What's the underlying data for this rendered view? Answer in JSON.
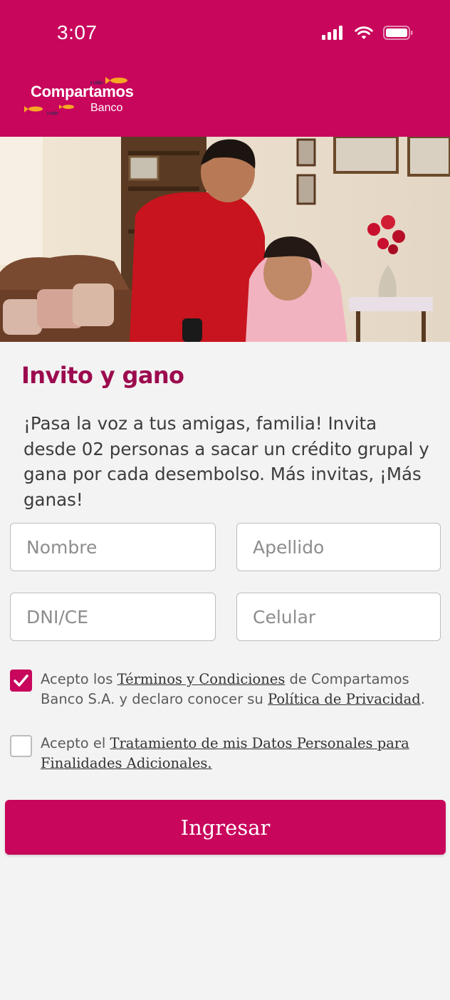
{
  "status_bar": {
    "time": "3:07"
  },
  "brand": {
    "name": "Compartamos",
    "sub": "Banco"
  },
  "page": {
    "title": "Invito y gano",
    "description": "¡Pasa la voz a tus amigas, familia! Invita desde 02 personas a sacar un crédito grupal y gana por cada desembolso. Más invitas, ¡Más ganas!"
  },
  "form": {
    "nombre_placeholder": "Nombre",
    "apellido_placeholder": "Apellido",
    "dni_placeholder": "DNI/CE",
    "celular_placeholder": "Celular"
  },
  "consents": {
    "terms": {
      "checked": true,
      "pre": "Acepto los ",
      "link1": "Términos y Condiciones",
      "mid": " de Compartamos Banco S.A. y declaro conocer su ",
      "link2": "Política de Privacidad",
      "post": "."
    },
    "data": {
      "checked": false,
      "pre": "Acepto el ",
      "link": "Tratamiento de mis Datos Personales para Finalidades Adicionales."
    }
  },
  "submit_label": "Ingresar",
  "colors": {
    "brand": "#c8065c",
    "title": "#9c0b4e",
    "background": "#f3f3f3"
  },
  "icons": [
    "signal-icon",
    "wifi-icon",
    "battery-icon",
    "checkmark-icon"
  ]
}
